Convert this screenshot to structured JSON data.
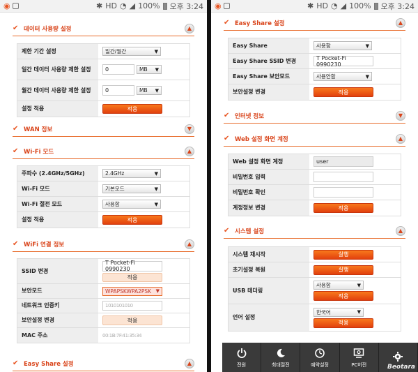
{
  "status": {
    "time": "오후 3:24",
    "battery": "100%",
    "net": "HD"
  },
  "left": {
    "sec_data": {
      "title": "데이터 사용량 설정",
      "toggle": "▲"
    },
    "data_rows": [
      {
        "label": "제한 기간 설정",
        "select": "일간/월간"
      },
      {
        "label": "일간 데이터 사용량 제한 설정",
        "value": "0",
        "unit": "MB"
      },
      {
        "label": "월간 데이터 사용량 제한 설정",
        "value": "0",
        "unit": "MB"
      },
      {
        "label": "설정 적용",
        "button": "적용"
      }
    ],
    "sec_wan": {
      "title": "WAN 정보",
      "toggle": "▼"
    },
    "sec_wifi": {
      "title": "Wi-Fi 모드",
      "toggle": "▲"
    },
    "wifi_rows": [
      {
        "label": "주파수 (2.4GHz/5GHz)",
        "select": "2.4GHz"
      },
      {
        "label": "Wi-Fi 모드",
        "select": "기본모드"
      },
      {
        "label": "Wi-Fi 절전 모드",
        "select": "사용함"
      },
      {
        "label": "설정 적용",
        "button": "적용"
      }
    ],
    "sec_wificonn": {
      "title": "WiFi 연결 정보",
      "toggle": "▲"
    },
    "conn_rows": [
      {
        "label": "SSID 변경",
        "value": "T Pocket-Fi 0990230",
        "button": "적용"
      },
      {
        "label": "보안모드",
        "select": "WPAPSKWPA2PSK"
      },
      {
        "label": "네트워크 인증키",
        "value": "1010101010"
      },
      {
        "label": "보안설정 변경",
        "button": "적용"
      },
      {
        "label": "MAC 주소",
        "value": "00:1B:7F:41:35:34"
      }
    ],
    "sec_easy": {
      "title": "Easy Share 설정",
      "toggle": "▲"
    }
  },
  "right": {
    "sec_easy": {
      "title": "Easy Share 설정",
      "toggle": "▲"
    },
    "easy_rows": [
      {
        "label": "Easy Share",
        "select": "사용함"
      },
      {
        "label": "Easy Share SSID 변경",
        "value": "T Pocket-Fi 0990230"
      },
      {
        "label": "Easy Share 보안모드",
        "select": "사용안함"
      },
      {
        "label": "보안설정 변경",
        "button": "적용"
      }
    ],
    "sec_internet": {
      "title": "인터넷 정보",
      "toggle": "▼"
    },
    "sec_web": {
      "title": "Web 설정 화면 계정",
      "toggle": "▲"
    },
    "web_rows": [
      {
        "label": "Web 설정 화면 계정",
        "value": "user"
      },
      {
        "label": "비밀번호 입력",
        "value": ""
      },
      {
        "label": "비밀번호 확인",
        "value": ""
      },
      {
        "label": "계정정보 변경",
        "button": "적용"
      }
    ],
    "sec_system": {
      "title": "시스템 설정",
      "toggle": "▲"
    },
    "system_rows": [
      {
        "label": "시스템 재시작",
        "button": "실행"
      },
      {
        "label": "초기설정 복원",
        "button": "실행"
      },
      {
        "label": "USB 테더링",
        "select": "사용함",
        "button": "적용"
      },
      {
        "label": "언어 설정",
        "select": "한국어",
        "button": "적용"
      }
    ],
    "bottom": [
      "전원",
      "최대절전",
      "예약설정",
      "PC버전",
      ""
    ],
    "watermark": "Beotara"
  }
}
